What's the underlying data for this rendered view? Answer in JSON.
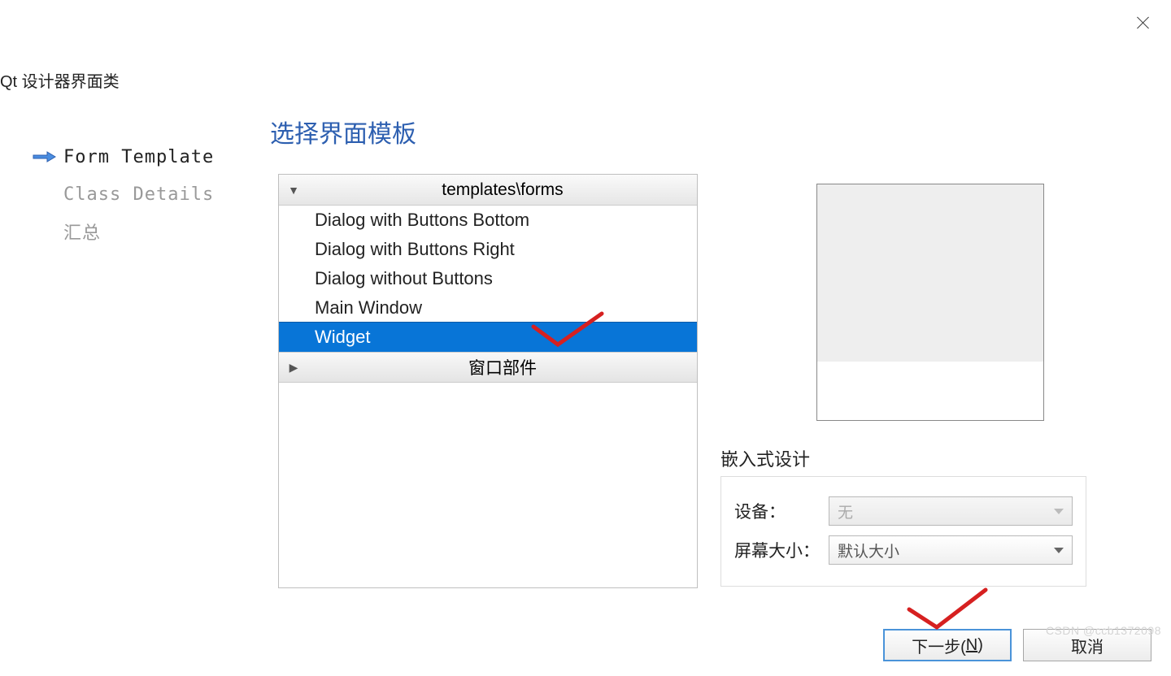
{
  "window": {
    "title": "Qt 设计器界面类"
  },
  "sidebar": {
    "items": [
      {
        "label": "Form Template",
        "active": true
      },
      {
        "label": "Class Details",
        "active": false
      },
      {
        "label": "汇总",
        "active": false
      }
    ]
  },
  "main": {
    "heading": "选择界面模板",
    "tree": {
      "group1_label": "templates\\forms",
      "items": [
        "Dialog with Buttons Bottom",
        "Dialog with Buttons Right",
        "Dialog without Buttons",
        "Main Window",
        "Widget"
      ],
      "selected_index": 4,
      "group2_label": "窗口部件"
    }
  },
  "embedded": {
    "group_title": "嵌入式设计",
    "device_label": "设备：",
    "device_value": "无",
    "screen_label": "屏幕大小：",
    "screen_value": "默认大小"
  },
  "buttons": {
    "next_prefix": "下一步(",
    "next_mnemonic": "N",
    "next_suffix": ")",
    "cancel": "取消"
  },
  "watermark": "CSDN @ccb1372098"
}
